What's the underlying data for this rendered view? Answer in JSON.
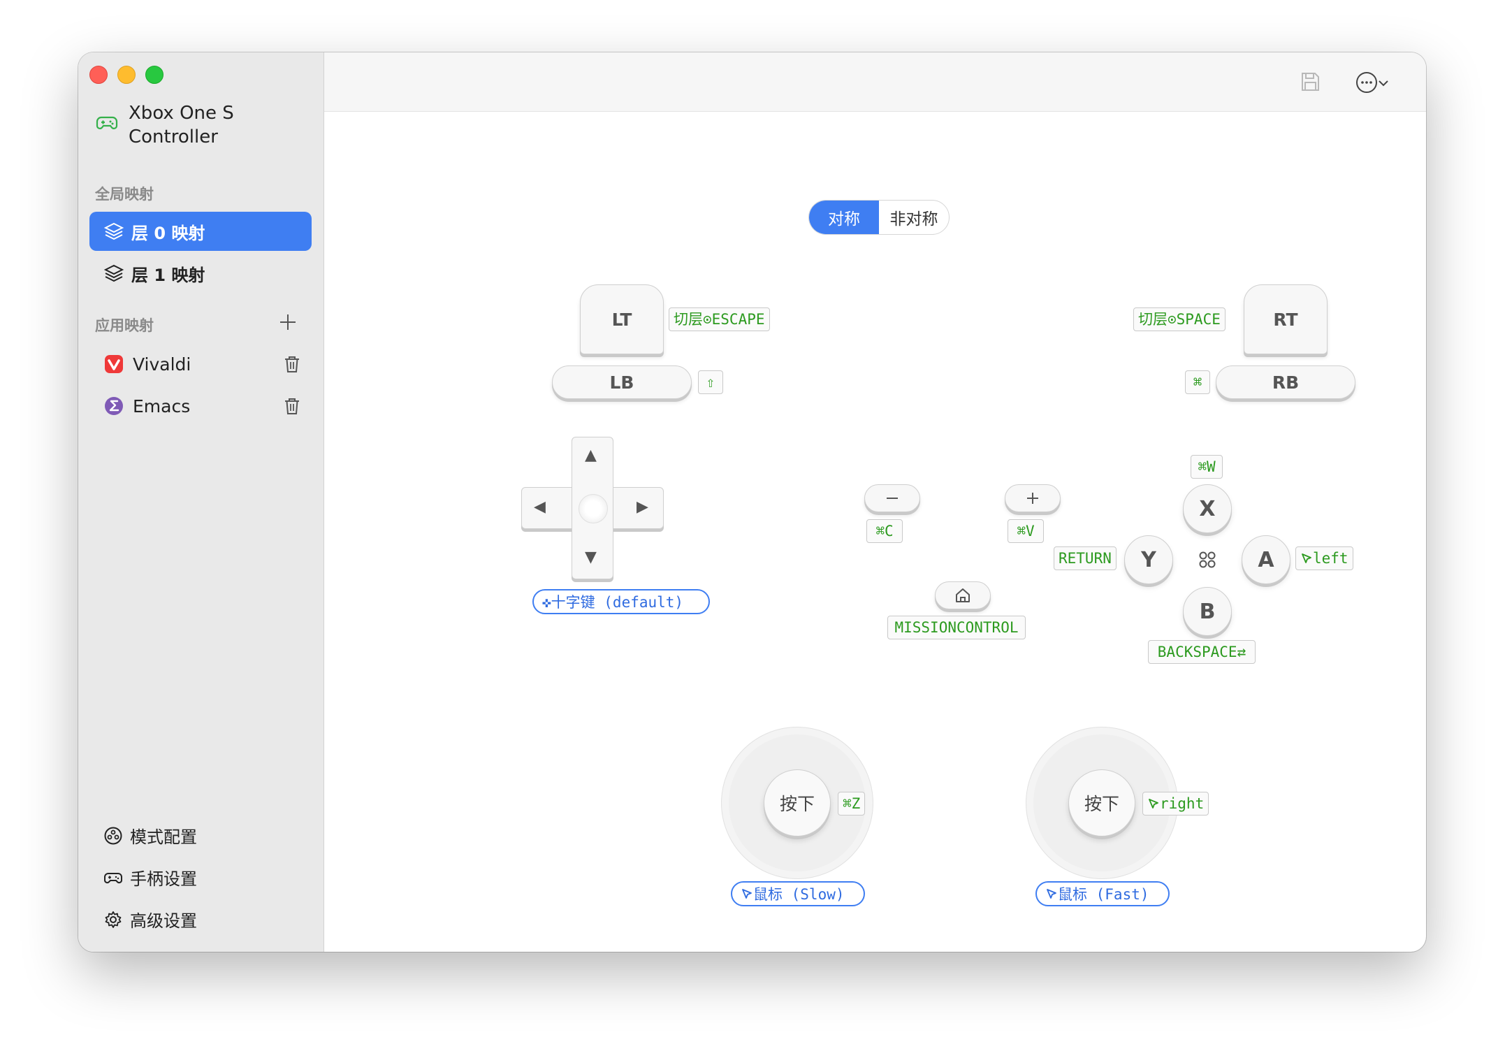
{
  "sidebar": {
    "device_name": "Xbox One S Controller",
    "global_section": "全局映射",
    "layers": [
      {
        "label": "层 0 映射",
        "active": true
      },
      {
        "label": "层 1 映射",
        "active": false
      }
    ],
    "app_section": "应用映射",
    "apps": [
      {
        "label": "Vivaldi",
        "icon": "vivaldi-logo"
      },
      {
        "label": "Emacs",
        "icon": "emacs-logo"
      }
    ],
    "bottom": [
      {
        "label": "模式配置",
        "icon": "mode-icon"
      },
      {
        "label": "手柄设置",
        "icon": "gamepad-icon"
      },
      {
        "label": "高级设置",
        "icon": "gear-icon"
      }
    ]
  },
  "toolbar": {
    "save": "save-icon",
    "more": "ellipsis-icon"
  },
  "segment": {
    "symmetric": "对称",
    "asymmetric": "非对称",
    "selected": "对称"
  },
  "controller": {
    "lt": {
      "label": "LT",
      "mapping": "切层⊙ESCAPE"
    },
    "lb": {
      "label": "LB",
      "mapping": "⇧"
    },
    "rt": {
      "label": "RT",
      "mapping": "切层⊙SPACE"
    },
    "rb": {
      "label": "RB",
      "mapping": "⌘"
    },
    "minus": {
      "mapping": "⌘C"
    },
    "plus": {
      "mapping": "⌘V"
    },
    "home": {
      "mapping": "MISSIONCONTROL"
    },
    "dpad": {
      "mode": "✜十字键 (default)"
    },
    "x": {
      "label": "X",
      "mapping": "⌘W"
    },
    "y": {
      "label": "Y",
      "mapping": "RETURN"
    },
    "a": {
      "label": "A",
      "mapping": "left"
    },
    "b": {
      "label": "B",
      "mapping": "BACKSPACE⇄"
    },
    "left_stick": {
      "press_label": "按下",
      "press_mapping": "⌘Z",
      "mode": "鼠标 (Slow)"
    },
    "right_stick": {
      "press_label": "按下",
      "press_mapping": "right",
      "mode": "鼠标 (Fast)"
    }
  },
  "colors": {
    "accent": "#3f7ef2",
    "mapping_text": "#2c9a1f"
  }
}
